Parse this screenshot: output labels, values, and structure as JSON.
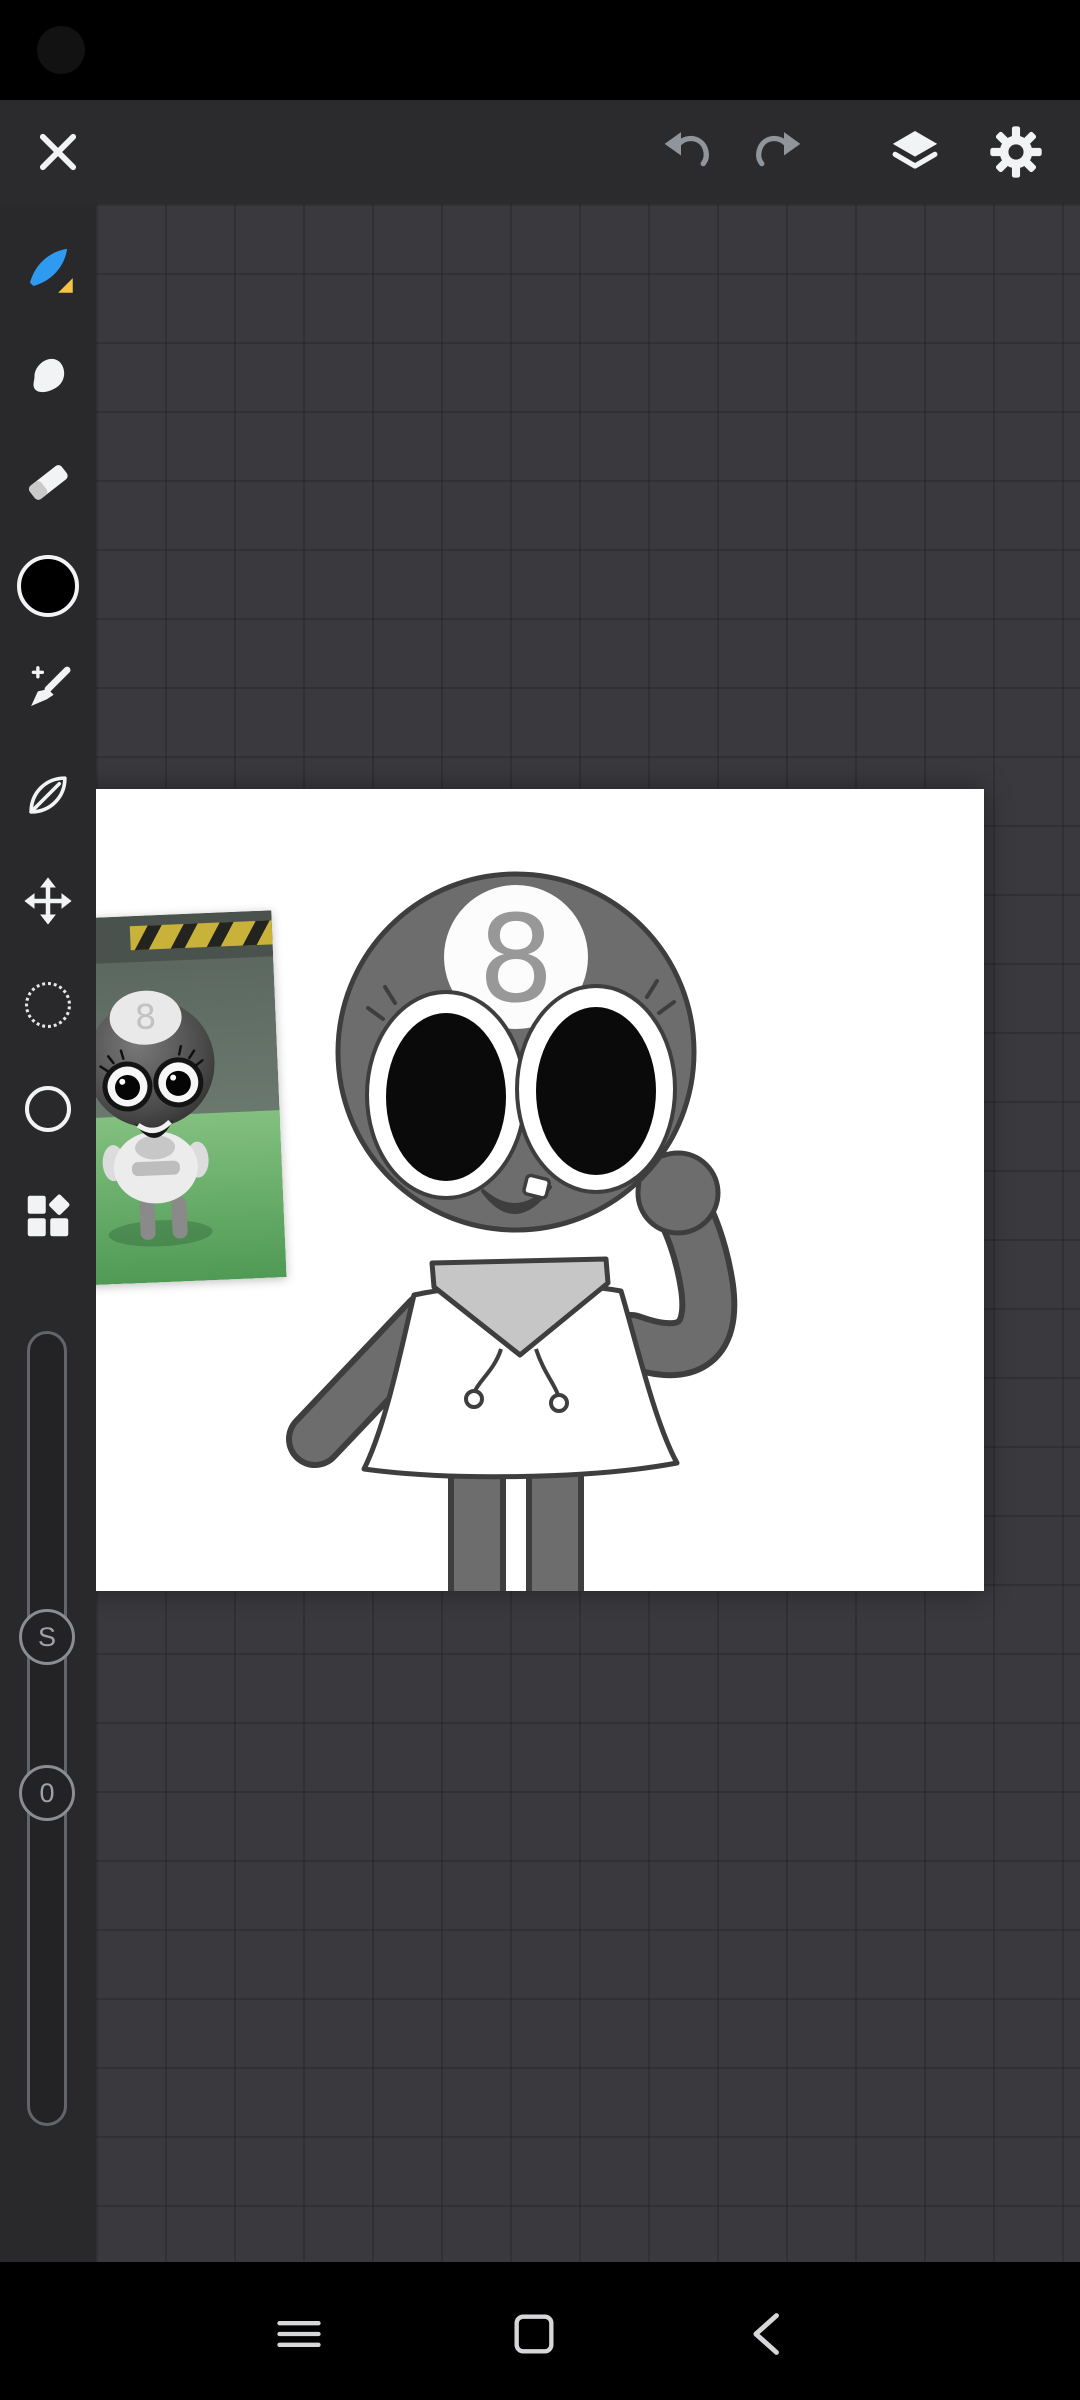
{
  "app": {
    "name": "paint-editor"
  },
  "colors": {
    "accent_blue": "#2f9bf0",
    "tool_badge_yellow": "#f6c445",
    "current_color": "#000000",
    "canvas_white": "#ffffff",
    "topbar_bg": "#2b2b2e",
    "sidebar_bg": "#29292c",
    "workspace_bg": "#3a3a3e",
    "statusbar_bg": "#000000",
    "navbar_bg": "#000000"
  },
  "topbar": {
    "buttons": [
      {
        "name": "close",
        "icon": "close-x-icon"
      },
      {
        "name": "undo",
        "icon": "undo-arrow-icon"
      },
      {
        "name": "redo",
        "icon": "redo-arrow-icon"
      },
      {
        "name": "layers",
        "icon": "layers-stack-icon"
      },
      {
        "name": "settings",
        "icon": "gear-icon"
      }
    ]
  },
  "sidebar": {
    "tools": [
      {
        "id": "brush",
        "icon": "brush-nib-icon",
        "selected": true
      },
      {
        "id": "smudge",
        "icon": "smudge-blob-icon",
        "selected": false
      },
      {
        "id": "eraser",
        "icon": "eraser-icon",
        "selected": false
      },
      {
        "id": "color",
        "icon": "color-swatch",
        "selected": false
      },
      {
        "id": "paint-brush",
        "icon": "paint-brush-icon",
        "selected": false
      },
      {
        "id": "vector",
        "icon": "leaf-icon",
        "selected": false
      },
      {
        "id": "transform",
        "icon": "move-arrows-icon",
        "selected": false
      },
      {
        "id": "lasso",
        "icon": "dotted-circle-icon",
        "selected": false
      },
      {
        "id": "shape",
        "icon": "circle-outline-icon",
        "selected": false
      },
      {
        "id": "materials",
        "icon": "blocks-grid-icon",
        "selected": false
      }
    ],
    "sliders": [
      {
        "id": "stabilizer",
        "knob_label": "S"
      },
      {
        "id": "opacity",
        "knob_label": "0"
      }
    ]
  },
  "canvas": {
    "artwork": {
      "ball_number": "8",
      "description": "gray 8-ball cartoon character in white hoodie, one arm raised"
    },
    "reference_photo": {
      "ball_number": "8",
      "description": "3D render reference of 8-ball character on green floor"
    }
  },
  "navbar": {
    "buttons": [
      {
        "name": "menu",
        "icon": "hamburger-icon"
      },
      {
        "name": "overview",
        "icon": "square-outline-icon"
      },
      {
        "name": "back",
        "icon": "back-chevron-icon"
      }
    ]
  }
}
